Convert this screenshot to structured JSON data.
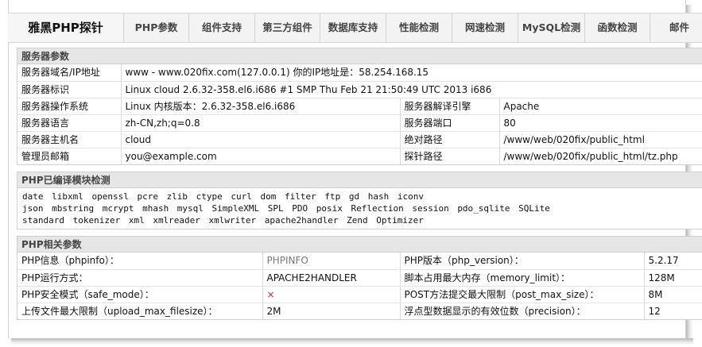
{
  "nav": {
    "brand": "雅黑PHP探针",
    "items": [
      "PHP参数",
      "组件支持",
      "第三方组件",
      "数据库支持",
      "性能检测",
      "网速检测",
      "MySQL检测",
      "函数检测",
      "邮件"
    ]
  },
  "server": {
    "title": "服务器参数",
    "rows": [
      {
        "label": "服务器域名/IP地址",
        "value": "www - www.020fix.com(127.0.0.1)  你的IP地址是：58.254.168.15"
      },
      {
        "label": "服务器标识",
        "value": "Linux cloud 2.6.32-358.el6.i686 #1 SMP Thu Feb 21 21:50:49 UTC 2013 i686"
      },
      {
        "label": "服务器操作系统",
        "value": "Linux  内核版本：2.6.32-358.el6.i686",
        "label2": "服务器解译引擎",
        "value2": "Apache"
      },
      {
        "label": "服务器语言",
        "value": "zh-CN,zh;q=0.8",
        "label2": "服务器端口",
        "value2": "80"
      },
      {
        "label": "服务器主机名",
        "value": "cloud",
        "label2": "绝对路径",
        "value2": "/www/web/020fix/public_html"
      },
      {
        "label": "管理员邮箱",
        "value": "you@example.com",
        "label2": "探针路径",
        "value2": "/www/web/020fix/public_html/tz.php"
      }
    ]
  },
  "modules": {
    "title": "PHP已编译模块检测",
    "lines": [
      "date  libxml  openssl  pcre  zlib  ctype  curl  dom  filter  ftp  gd  hash  iconv",
      "json  mbstring  mcrypt  mhash  mysql  SimpleXML  SPL  PDO  posix  Reflection  session  pdo_sqlite  SQLite",
      "standard  tokenizer  xml  xmlreader  xmlwriter  apache2handler  Zend Optimizer"
    ]
  },
  "php": {
    "title": "PHP相关参数",
    "rows": [
      {
        "label": "PHP信息（phpinfo）：",
        "value": "PHPINFO",
        "label2": "PHP版本（php_version）：",
        "value2": "5.2.17"
      },
      {
        "label": "PHP运行方式：",
        "value": "APACHE2HANDLER",
        "label2": "脚本占用最大内存（memory_limit）：",
        "value2": "128M"
      },
      {
        "label": "PHP安全模式（safe_mode）：",
        "value": "×",
        "label2": "POST方法提交最大限制（post_max_size）：",
        "value2": "8M"
      },
      {
        "label": "上传文件最大限制（upload_max_filesize）：",
        "value": "2M",
        "label2": "浮点型数据显示的有效位数（precision）：",
        "value2": "12"
      }
    ]
  }
}
